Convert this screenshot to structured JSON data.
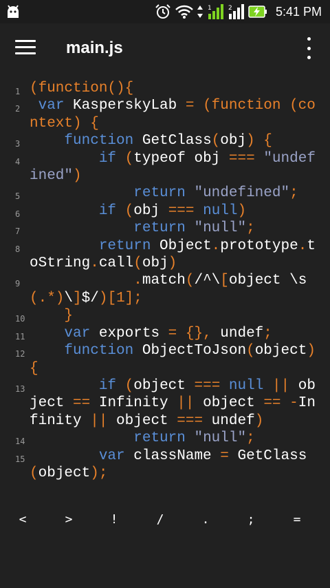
{
  "status": {
    "time": "5:41 PM"
  },
  "app_bar": {
    "title": "main.js"
  },
  "colors": {
    "background": "#212121",
    "keyword": "#5a8fd8",
    "punctuation": "#e8812a",
    "string": "#9aa3c8",
    "plain": "#ffffff",
    "battery": "#7ed321"
  },
  "editor": {
    "lines": [
      {
        "num": "1",
        "tokens": [
          [
            "p",
            "(function(){"
          ]
        ]
      },
      {
        "num": "2",
        "tokens": [
          [
            "t",
            " "
          ],
          [
            "k",
            "var"
          ],
          [
            "t",
            " KasperskyLab "
          ],
          [
            "p",
            "= (function (context) {"
          ]
        ]
      },
      {
        "num": "3",
        "tokens": [
          [
            "t",
            "    "
          ],
          [
            "k",
            "function"
          ],
          [
            "t",
            " GetClass"
          ],
          [
            "p",
            "("
          ],
          [
            "t",
            "obj"
          ],
          [
            "p",
            ") {"
          ]
        ]
      },
      {
        "num": "4",
        "tokens": [
          [
            "t",
            "        "
          ],
          [
            "k",
            "if"
          ],
          [
            "t",
            " "
          ],
          [
            "p",
            "("
          ],
          [
            "t",
            "typeof obj "
          ],
          [
            "p",
            "==="
          ],
          [
            "t",
            " "
          ],
          [
            "s",
            "\"undefined\""
          ],
          [
            "p",
            ")"
          ]
        ]
      },
      {
        "num": "5",
        "tokens": [
          [
            "t",
            "            "
          ],
          [
            "k",
            "return"
          ],
          [
            "t",
            " "
          ],
          [
            "s",
            "\"undefined\""
          ],
          [
            "p",
            ";"
          ]
        ]
      },
      {
        "num": "6",
        "tokens": [
          [
            "t",
            "        "
          ],
          [
            "k",
            "if"
          ],
          [
            "t",
            " "
          ],
          [
            "p",
            "("
          ],
          [
            "t",
            "obj "
          ],
          [
            "p",
            "==="
          ],
          [
            "t",
            " "
          ],
          [
            "k",
            "null"
          ],
          [
            "p",
            ")"
          ]
        ]
      },
      {
        "num": "7",
        "tokens": [
          [
            "t",
            "            "
          ],
          [
            "k",
            "return"
          ],
          [
            "t",
            " "
          ],
          [
            "s",
            "\"null\""
          ],
          [
            "p",
            ";"
          ]
        ]
      },
      {
        "num": "8",
        "tokens": [
          [
            "t",
            "        "
          ],
          [
            "k",
            "return"
          ],
          [
            "t",
            " Object"
          ],
          [
            "p",
            "."
          ],
          [
            "t",
            "prototype"
          ],
          [
            "p",
            "."
          ],
          [
            "t",
            "toString"
          ],
          [
            "p",
            "."
          ],
          [
            "t",
            "call"
          ],
          [
            "p",
            "("
          ],
          [
            "t",
            "obj"
          ],
          [
            "p",
            ")"
          ]
        ]
      },
      {
        "num": "9",
        "tokens": [
          [
            "t",
            "            "
          ],
          [
            "p",
            "."
          ],
          [
            "t",
            "match"
          ],
          [
            "p",
            "("
          ],
          [
            "t",
            "/^\\"
          ],
          [
            "p",
            "["
          ],
          [
            "t",
            "object \\s"
          ],
          [
            "p",
            "(.*)"
          ],
          [
            "t",
            "\\"
          ],
          [
            "p",
            "]"
          ],
          [
            "t",
            "$/"
          ],
          [
            "p",
            ")[1];"
          ]
        ]
      },
      {
        "num": "10",
        "tokens": [
          [
            "t",
            "    "
          ],
          [
            "p",
            "}"
          ]
        ]
      },
      {
        "num": "11",
        "tokens": [
          [
            "t",
            "    "
          ],
          [
            "k",
            "var"
          ],
          [
            "t",
            " exports "
          ],
          [
            "p",
            "= {},"
          ],
          [
            "t",
            " undef"
          ],
          [
            "p",
            ";"
          ]
        ]
      },
      {
        "num": "12",
        "tokens": [
          [
            "t",
            "    "
          ],
          [
            "k",
            "function"
          ],
          [
            "t",
            " ObjectToJson"
          ],
          [
            "p",
            "("
          ],
          [
            "t",
            "object"
          ],
          [
            "p",
            ") {"
          ]
        ]
      },
      {
        "num": "13",
        "tokens": [
          [
            "t",
            "        "
          ],
          [
            "k",
            "if"
          ],
          [
            "t",
            " "
          ],
          [
            "p",
            "("
          ],
          [
            "t",
            "object "
          ],
          [
            "p",
            "==="
          ],
          [
            "t",
            " "
          ],
          [
            "k",
            "null"
          ],
          [
            "t",
            " "
          ],
          [
            "p",
            "||"
          ],
          [
            "t",
            " object "
          ],
          [
            "p",
            "=="
          ],
          [
            "t",
            " Infinity "
          ],
          [
            "p",
            "||"
          ],
          [
            "t",
            " object "
          ],
          [
            "p",
            "== -"
          ],
          [
            "t",
            "Infinity "
          ],
          [
            "p",
            "||"
          ],
          [
            "t",
            " object "
          ],
          [
            "p",
            "==="
          ],
          [
            "t",
            " undef"
          ],
          [
            "p",
            ")"
          ]
        ]
      },
      {
        "num": "14",
        "tokens": [
          [
            "t",
            "            "
          ],
          [
            "k",
            "return"
          ],
          [
            "t",
            " "
          ],
          [
            "s",
            "\"null\""
          ],
          [
            "p",
            ";"
          ]
        ]
      },
      {
        "num": "15",
        "tokens": [
          [
            "t",
            "        "
          ],
          [
            "k",
            "var"
          ],
          [
            "t",
            " className "
          ],
          [
            "p",
            "="
          ],
          [
            "t",
            " GetClass"
          ],
          [
            "p",
            "("
          ],
          [
            "t",
            "object"
          ],
          [
            "p",
            ");"
          ]
        ]
      }
    ]
  },
  "symbols": [
    "<",
    ">",
    "!",
    "/",
    ".",
    ";",
    "="
  ]
}
